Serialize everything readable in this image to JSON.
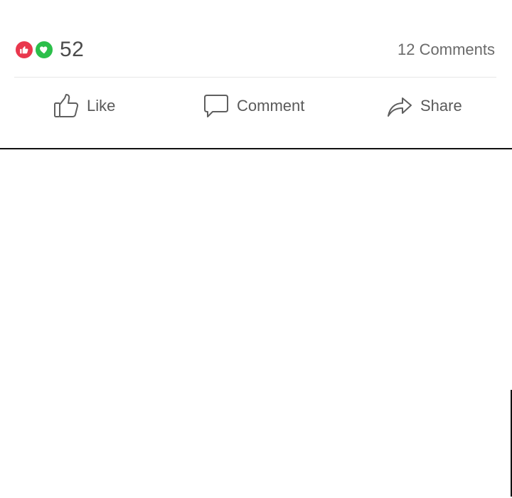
{
  "reactions": {
    "count": "52",
    "icons": [
      "thumbs-up-icon",
      "heart-icon"
    ],
    "colors": {
      "like": "#e9374d",
      "love": "#2bbf4a"
    }
  },
  "comments": {
    "label": "12 Comments"
  },
  "actions": {
    "like_label": "Like",
    "comment_label": "Comment",
    "share_label": "Share"
  }
}
